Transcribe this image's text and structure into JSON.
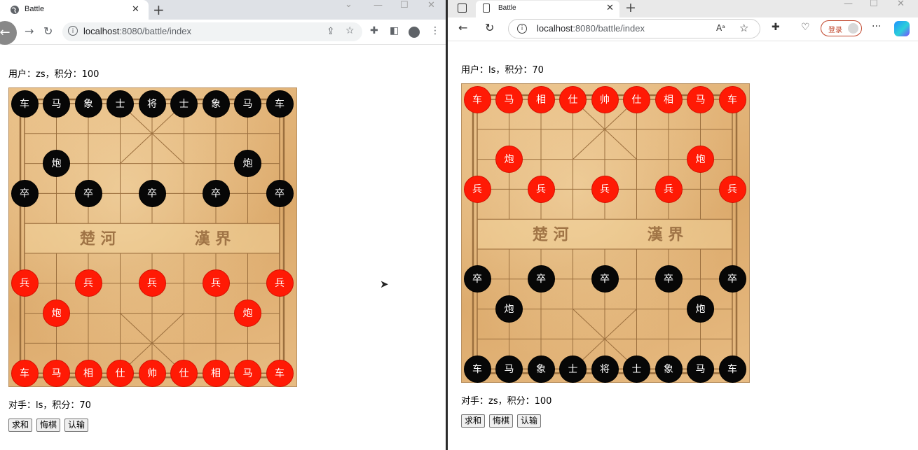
{
  "windows": {
    "left": {
      "browser": "chrome",
      "tab_title": "Battle",
      "url_host": "localhost",
      "url_rest": ":8080/battle/index",
      "user_line": "用户：zs，积分：100",
      "opponent_line": "对手：ls，积分：70",
      "top_color": "black"
    },
    "right": {
      "browser": "edge",
      "tab_title": "Battle",
      "url_host": "localhost",
      "url_rest": ":8080/battle/index",
      "login_label": "登录",
      "user_line": "用户：ls，积分：70",
      "opponent_line": "对手：zs，积分：100",
      "top_color": "red"
    }
  },
  "buttons": {
    "peace": "求和",
    "undo": "悔棋",
    "resign": "认输"
  },
  "board": {
    "river_left": "楚 河",
    "river_right": "漢 界",
    "black_back_row": [
      "车",
      "马",
      "象",
      "士",
      "将",
      "士",
      "象",
      "马",
      "车"
    ],
    "black_cannon": "炮",
    "black_soldier": "卒",
    "red_back_row": [
      "车",
      "马",
      "相",
      "仕",
      "帅",
      "仕",
      "相",
      "马",
      "车"
    ],
    "red_cannon": "炮",
    "red_soldier": "兵"
  },
  "colors": {
    "red_piece": "#ff1a05",
    "black_piece": "#070707",
    "board": "#e2b47a"
  },
  "icons": {
    "chrome": [
      "globe-icon",
      "close-icon",
      "plus-icon",
      "back-icon",
      "forward-icon",
      "reload-icon",
      "info-icon",
      "share-icon",
      "star-icon",
      "puzzle-icon",
      "sidepanel-icon",
      "profile-icon",
      "menu-icon"
    ],
    "edge": [
      "tabs-icon",
      "page-icon",
      "close-icon",
      "plus-icon",
      "back-icon",
      "reload-icon",
      "info-icon",
      "read-aloud-icon",
      "star-icon",
      "extensions-icon",
      "health-icon",
      "profile-icon",
      "more-icon",
      "copilot-icon"
    ]
  }
}
